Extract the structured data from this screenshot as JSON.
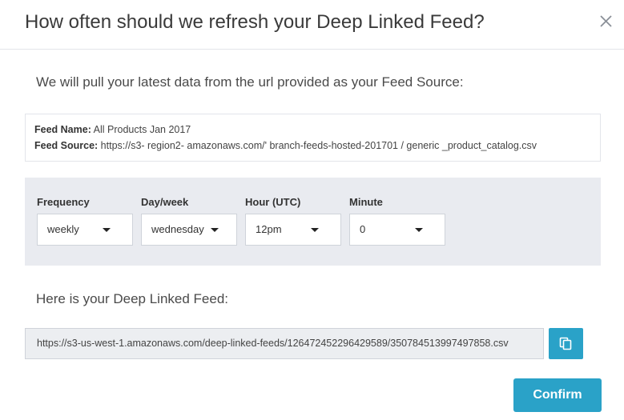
{
  "modal": {
    "title": "How often should we refresh your Deep Linked Feed?"
  },
  "intro_text": "We will pull your latest data from the url provided as your Feed Source:",
  "feed_info": {
    "name_label": "Feed Name:",
    "name_value": "All Products Jan 2017",
    "source_label": "Feed Source:",
    "source_value": "https://s3- region2- amazonaws.com/' branch-feeds-hosted-201701  / generic _product_catalog.csv"
  },
  "schedule": {
    "frequency": {
      "label": "Frequency",
      "value": "weekly"
    },
    "dayweek": {
      "label": "Day/week",
      "value": "wednesday"
    },
    "hour": {
      "label": "Hour (UTC)",
      "value": "12pm"
    },
    "minute": {
      "label": "Minute",
      "value": "0"
    }
  },
  "deep_linked_feed": {
    "label": "Here is your Deep Linked Feed:",
    "url": "https://s3-us-west-1.amazonaws.com/deep-linked-feeds/126472452296429589/350784513997497858.csv"
  },
  "actions": {
    "confirm_label": "Confirm"
  },
  "icons": {
    "close": "close-icon",
    "copy": "copy-icon",
    "caret": "caret-down-icon"
  },
  "colors": {
    "accent": "#2aa2c8",
    "panel": "#e9ebf0"
  }
}
